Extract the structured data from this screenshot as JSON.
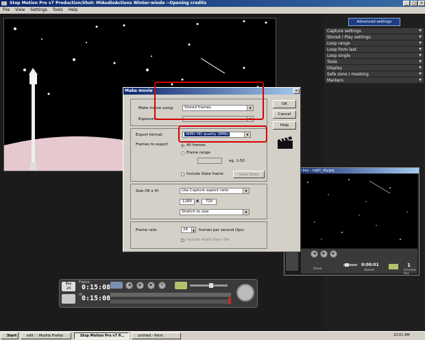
{
  "window": {
    "title": "Stop Motion Pro v7  Production/Shot: MiAudioActions Winter-winde  --Opening credits",
    "controls": [
      "_",
      "□",
      "×"
    ]
  },
  "menu": [
    "File",
    "View",
    "Settings",
    "Tools",
    "Help"
  ],
  "right_panel": {
    "advanced_label": "Advanced settings",
    "items": [
      "Capture settings",
      "Stored / Play settings",
      "Loop range",
      "Loop from last",
      "Loop single",
      "Tools",
      "Display",
      "Safe zone / masking",
      "Markers"
    ]
  },
  "dialog": {
    "title": "Make movie",
    "make_movie_using_label": "Make movie using:",
    "make_movie_using_value": "Stored frames",
    "exposure_label": "Exposure:",
    "export_format_label": "Export format:",
    "export_format_value": "WMV HD quality (8Mb)",
    "frames_to_export_label": "Frames to export",
    "all_frames": "All frames",
    "frame_range": "Frame range",
    "range_hint": "eg. 1-50",
    "include_slate": "Include Slate frame",
    "view_slate": "View Slate",
    "size_label": "Size (W x H)",
    "size_value": "Use Capture aspect ratio",
    "width": "1280",
    "times": "X",
    "height": "720",
    "stretch_value": "Stretch to size",
    "frame_rate_label": "Frame rate:",
    "frame_rate_value": "24",
    "frame_rate_unit": "frames per second (fps)",
    "include_audio": "Include Audio Sync file",
    "ok": "OK",
    "cancel": "Cancel",
    "help": "Help"
  },
  "player": {
    "frame_label": "Frame",
    "time_top": "0:15:08",
    "time_bottom": "0:15:08",
    "fps_label": "Key",
    "fps_value": "24",
    "of_label": "of"
  },
  "key_window": {
    "title": "a key - night_sky.jpg",
    "time": "0:00:01",
    "stored_label": "Stored",
    "chroma_label": "Chroma key",
    "chroma_value": "1",
    "show_label": "Show"
  },
  "taskbar": {
    "start": "Start",
    "tasks": [
      "edit : : Mozilla Firefox",
      "Stop Motion Pro v7  P...",
      "untitled - Paint"
    ],
    "clock": "10:01 AM"
  },
  "colors": {
    "highlight_red": "#d40000",
    "title_blue": "#0a246a"
  }
}
